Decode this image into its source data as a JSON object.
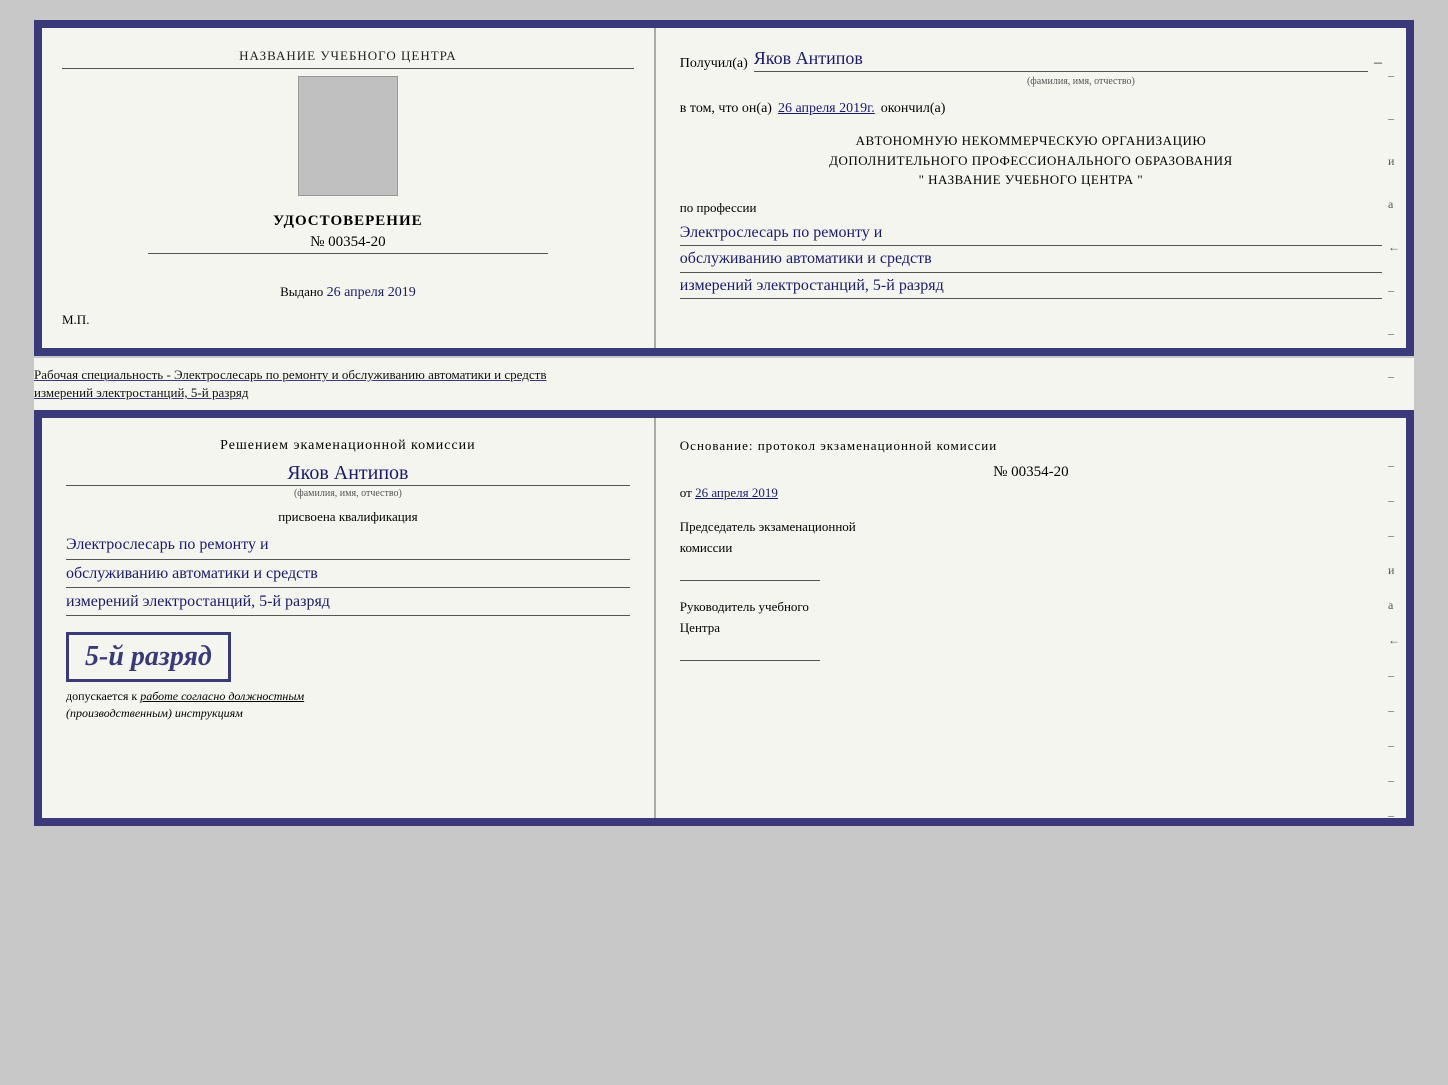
{
  "topDoc": {
    "leftPanel": {
      "centerTitle": "НАЗВАНИЕ УЧЕБНОГО ЦЕНТРА",
      "certTitle": "УДОСТОВЕРЕНИЕ",
      "certNumber": "№ 00354-20",
      "issuedLabel": "Выдано",
      "issuedDate": "26 апреля 2019",
      "mpLabel": "М.П."
    },
    "rightPanel": {
      "recipientLabel": "Получил(а)",
      "recipientName": "Яков Антипов",
      "recipientSubLabel": "(фамилия, имя, отчество)",
      "dash": "–",
      "confirmPrefix": "в том, что он(а)",
      "confirmDate": "26 апреля 2019г.",
      "confirmSuffix": "окончил(а)",
      "orgLine1": "АВТОНОМНУЮ НЕКОММЕРЧЕСКУЮ ОРГАНИЗАЦИЮ",
      "orgLine2": "ДОПОЛНИТЕЛЬНОГО ПРОФЕССИОНАЛЬНОГО ОБРАЗОВАНИЯ",
      "orgLine3": "\" НАЗВАНИЕ УЧЕБНОГО ЦЕНТРА \"",
      "professionLabel": "по профессии",
      "professionLine1": "Электрослесарь по ремонту и",
      "professionLine2": "обслуживанию автоматики и средств",
      "professionLine3": "измерений электростанций, 5-й разряд"
    }
  },
  "separator": {
    "text1": "Рабочая специальность - Электрослесарь по ремонту и обслуживанию автоматики и средств",
    "text2": "измерений электростанций, 5-й разряд"
  },
  "bottomDoc": {
    "leftPanel": {
      "decisionText": "Решением экаменационной комиссии",
      "personName": "Яков Антипов",
      "personSubLabel": "(фамилия, имя, отчество)",
      "qualificationLabel": "присвоена квалификация",
      "qualLine1": "Электрослесарь по ремонту и",
      "qualLine2": "обслуживанию автоматики и средств",
      "qualLine3": "измерений электростанций, 5-й разряд",
      "rankText": "5-й разряд",
      "admitPrefix": "допускается к",
      "admitItalic": "работе согласно должностным",
      "admitItalic2": "(производственным) инструкциям"
    },
    "rightPanel": {
      "basisText": "Основание: протокол экзаменационной комиссии",
      "protocolNumber": "№ 00354-20",
      "protocolDatePrefix": "от",
      "protocolDate": "26 апреля 2019",
      "chairmanLabel": "Председатель экзаменационной",
      "chairmanLabel2": "комиссии",
      "directorLabel": "Руководитель учебного",
      "directorLabel2": "Центра"
    }
  }
}
